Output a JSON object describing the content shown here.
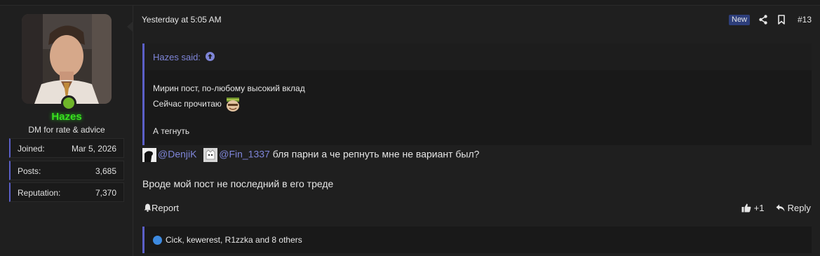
{
  "user": {
    "name": "Hazes",
    "title": "DM for rate & advice",
    "stats": [
      {
        "label": "Joined:",
        "value": "Mar 5, 2026"
      },
      {
        "label": "Posts:",
        "value": "3,685"
      },
      {
        "label": "Reputation:",
        "value": "7,370"
      }
    ]
  },
  "post": {
    "date": "Yesterday at 5:05 AM",
    "badge": "New",
    "number": "#13",
    "quote": {
      "author": "Hazes said:",
      "lines": [
        "Мирин пост, по-любому высокий вклад",
        "Сейчас прочитаю",
        "А тегнуть"
      ]
    },
    "mentions": [
      "@DenjiK",
      "@Fin_1337"
    ],
    "mention_suffix": "бля парни а че репнуть мне не вариант был?",
    "body": "Вроде мой пост не последний в его треде",
    "actions": {
      "report": "Report",
      "like": "+1",
      "reply": "Reply"
    },
    "reactions": "Cick, kewerest, R1zzka and 8 others"
  },
  "colors": {
    "accent": "#5b5fc7",
    "username": "#39e01f",
    "link": "#7e85d8",
    "online": "#6fb52a"
  }
}
